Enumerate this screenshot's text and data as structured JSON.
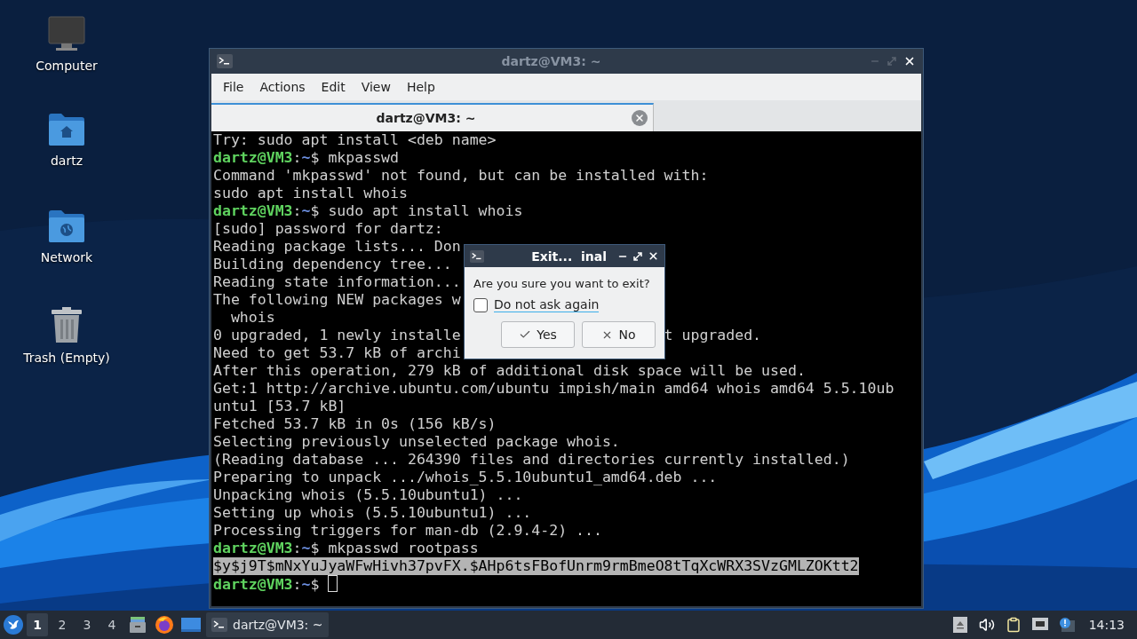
{
  "desktop": {
    "icons": [
      {
        "label": "Computer",
        "kind": "computer"
      },
      {
        "label": "dartz",
        "kind": "home"
      },
      {
        "label": "Network",
        "kind": "network"
      },
      {
        "label": "Trash (Empty)",
        "kind": "trash"
      }
    ]
  },
  "terminal_window": {
    "title": "dartz@VM3: ~",
    "menu": [
      "File",
      "Actions",
      "Edit",
      "View",
      "Help"
    ],
    "tabs": [
      {
        "label": "dartz@VM3: ~",
        "selected": true
      }
    ],
    "lines": [
      {
        "kind": "output",
        "text": "Try: sudo apt install <deb name>"
      },
      {
        "kind": "prompt",
        "host": "dartz@VM3",
        "sep": ":",
        "path": "~",
        "command": "$ mkpasswd"
      },
      {
        "kind": "output",
        "text": "Command 'mkpasswd' not found, but can be installed with:"
      },
      {
        "kind": "output",
        "text": "sudo apt install whois"
      },
      {
        "kind": "prompt",
        "host": "dartz@VM3",
        "sep": ":",
        "path": "~",
        "command": "$ sudo apt install whois"
      },
      {
        "kind": "output",
        "text": "[sudo] password for dartz:"
      },
      {
        "kind": "output",
        "text": "Reading package lists... Don"
      },
      {
        "kind": "output",
        "text": "Building dependency tree..."
      },
      {
        "kind": "output",
        "text": "Reading state information..."
      },
      {
        "kind": "output",
        "text": "The following NEW packages w"
      },
      {
        "kind": "output",
        "text": "  whois"
      },
      {
        "kind": "output",
        "text": "0 upgraded, 1 newly installe",
        "tail": "t upgraded."
      },
      {
        "kind": "output",
        "text": "Need to get 53.7 kB of archi"
      },
      {
        "kind": "output",
        "text": "After this operation, 279 kB of additional disk space will be used."
      },
      {
        "kind": "output",
        "text": "Get:1 http://archive.ubuntu.com/ubuntu impish/main amd64 whois amd64 5.5.10ub"
      },
      {
        "kind": "output",
        "text": "untu1 [53.7 kB]"
      },
      {
        "kind": "output",
        "text": "Fetched 53.7 kB in 0s (156 kB/s)"
      },
      {
        "kind": "output",
        "text": "Selecting previously unselected package whois."
      },
      {
        "kind": "output",
        "text": "(Reading database ... 264390 files and directories currently installed.)"
      },
      {
        "kind": "output",
        "text": "Preparing to unpack .../whois_5.5.10ubuntu1_amd64.deb ..."
      },
      {
        "kind": "output",
        "text": "Unpacking whois (5.5.10ubuntu1) ..."
      },
      {
        "kind": "output",
        "text": "Setting up whois (5.5.10ubuntu1) ..."
      },
      {
        "kind": "output",
        "text": "Processing triggers for man-db (2.9.4-2) ..."
      },
      {
        "kind": "prompt",
        "host": "dartz@VM3",
        "sep": ":",
        "path": "~",
        "command": "$ mkpasswd rootpass"
      },
      {
        "kind": "selected",
        "text": "$y$j9T$mNxYuJyaWFwHivh37pvFX.$AHp6tsFBofUnrm9rmBmeO8tTqXcWRX3SVzGMLZOKtt2"
      },
      {
        "kind": "prompt",
        "host": "dartz@VM3",
        "sep": ":",
        "path": "~",
        "command": "$",
        "cursor": true
      }
    ]
  },
  "dialog": {
    "title": "Exit...  inal",
    "message": "Are you sure you want to exit?",
    "checkbox": {
      "label": "Do not ask again",
      "checked": false
    },
    "buttons": [
      {
        "label": "Yes",
        "kind": "yes"
      },
      {
        "label": "No",
        "kind": "no"
      }
    ]
  },
  "taskbar": {
    "workspaces": [
      {
        "label": "1",
        "selected": true
      },
      {
        "label": "2",
        "selected": false
      },
      {
        "label": "3",
        "selected": false
      },
      {
        "label": "4",
        "selected": false
      }
    ],
    "tasks": [
      {
        "label": "dartz@VM3: ~",
        "selected": true
      }
    ],
    "clock": "14:13"
  }
}
